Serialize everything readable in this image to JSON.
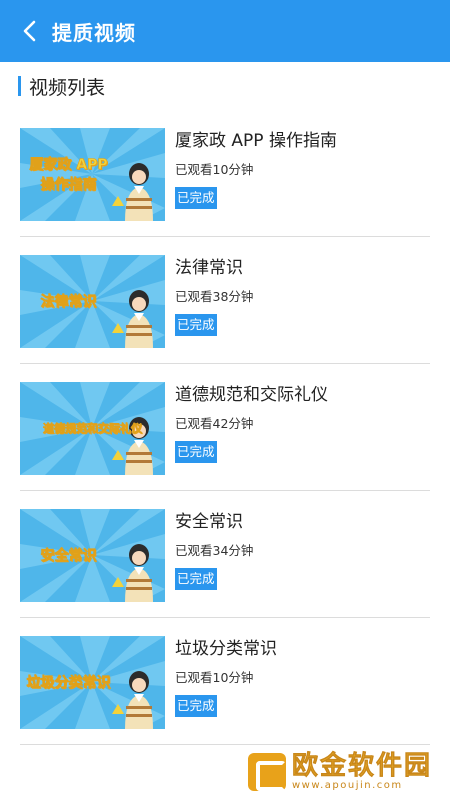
{
  "header": {
    "title": "提质视频"
  },
  "section": {
    "title": "视频列表"
  },
  "videos": [
    {
      "thumb_lines": [
        "厦家政 APP",
        "操作指南"
      ],
      "title": "厦家政 APP 操作指南",
      "watched": "已观看10分钟",
      "status": "已完成"
    },
    {
      "thumb_lines": [
        "法律常识"
      ],
      "title": "法律常识",
      "watched": "已观看38分钟",
      "status": "已完成"
    },
    {
      "thumb_lines": [
        "道德规范和交际礼仪"
      ],
      "title": "道德规范和交际礼仪",
      "watched": "已观看42分钟",
      "status": "已完成"
    },
    {
      "thumb_lines": [
        "安全常识"
      ],
      "title": "安全常识",
      "watched": "已观看34分钟",
      "status": "已完成"
    },
    {
      "thumb_lines": [
        "垃圾分类常识"
      ],
      "title": "垃圾分类常识",
      "watched": "已观看10分钟",
      "status": "已完成"
    }
  ],
  "watermark": {
    "name": "欧金软件园",
    "url": "www.apoujin.com"
  },
  "colors": {
    "primary": "#2a96ee",
    "thumb_bg": "#4fb6ea",
    "thumb_text": "#f4d23a"
  }
}
